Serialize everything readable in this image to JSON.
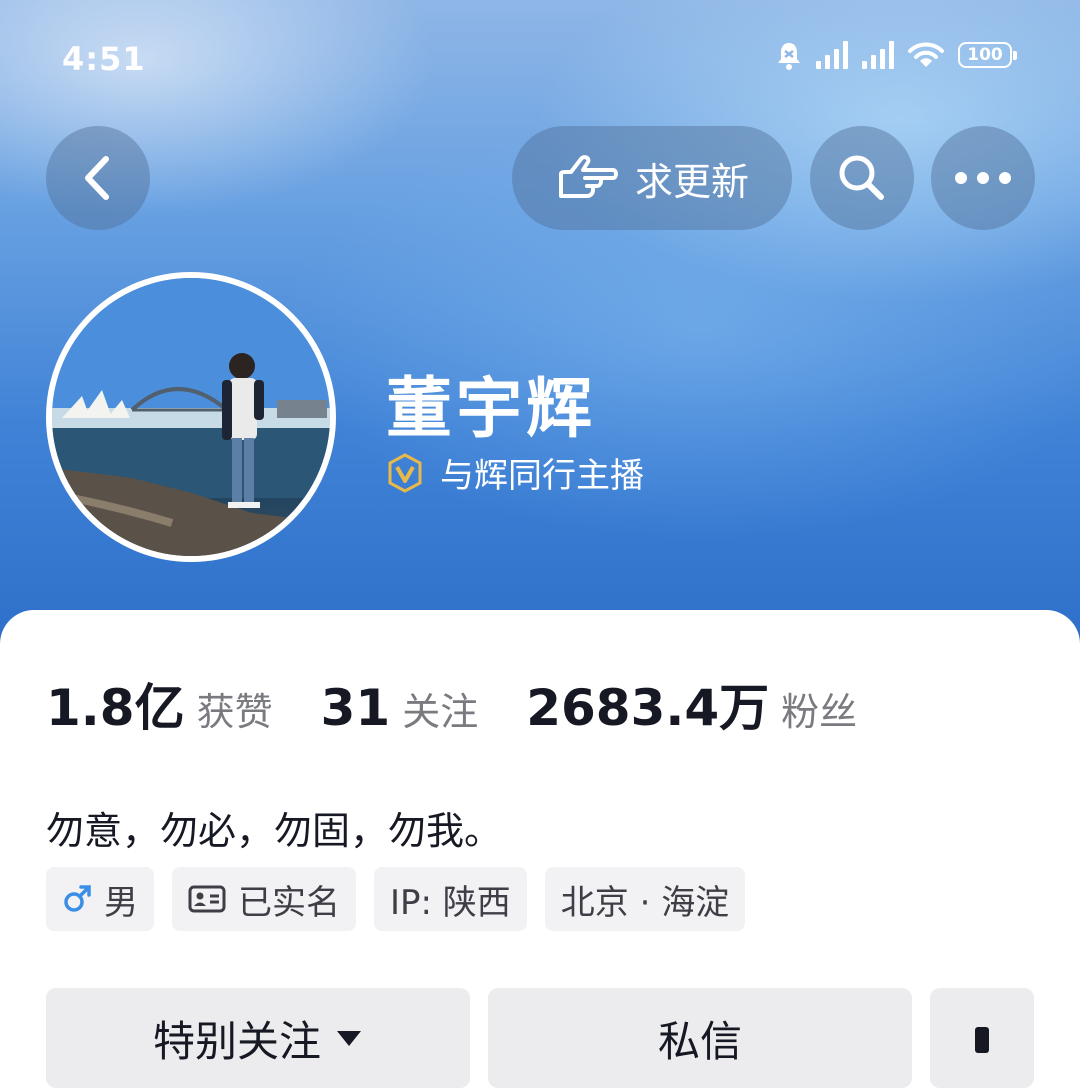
{
  "status_bar": {
    "time": "4:51",
    "battery": "100"
  },
  "top_bar": {
    "update_label": "求更新"
  },
  "profile": {
    "name": "董宇辉",
    "verify_label": "与辉同行主播"
  },
  "stats": [
    {
      "value": "1.8亿",
      "label": "获赞"
    },
    {
      "value": "31",
      "label": "关注"
    },
    {
      "value": "2683.4万",
      "label": "粉丝"
    }
  ],
  "bio": "勿意，勿必，勿固，勿我。",
  "tags": {
    "gender": "男",
    "realname": "已实名",
    "ip": "IP: 陕西",
    "location": "北京 · 海淀"
  },
  "actions": {
    "follow_label": "特别关注",
    "message_label": "私信"
  },
  "colors": {
    "accent_blue": "#3f82d6",
    "male_blue": "#3a8ee6",
    "verify_gold": "#e8b94a"
  }
}
